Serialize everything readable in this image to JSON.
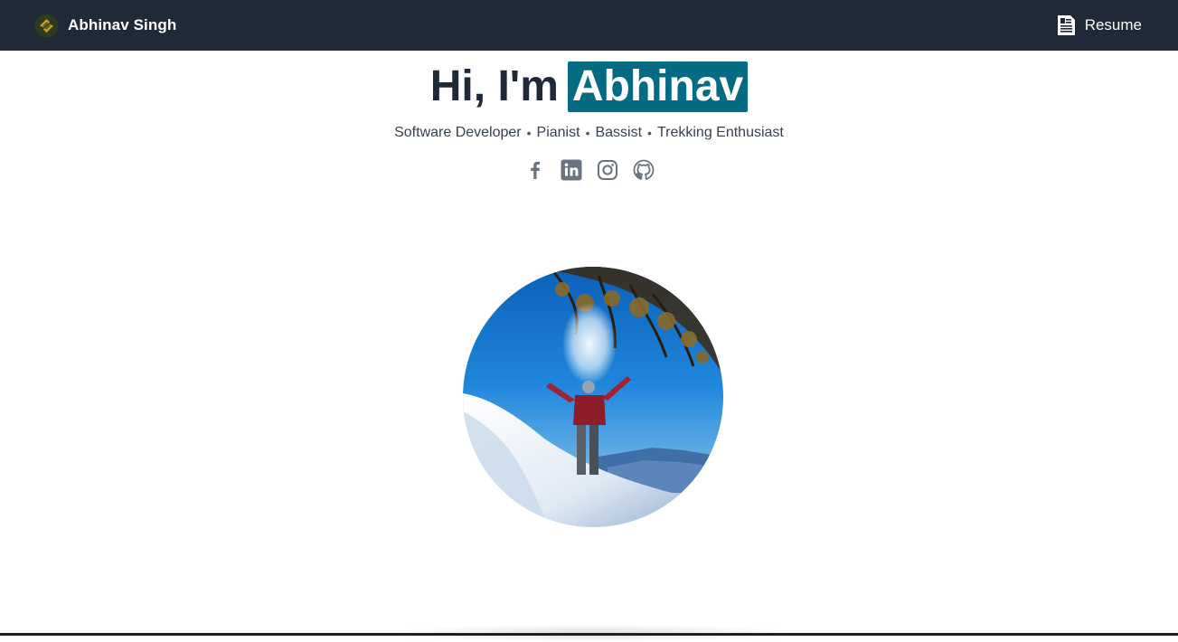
{
  "navbar": {
    "brand_name": "Abhinav Singh",
    "brand_logo_icon": "abhinav-logo-icon",
    "resume_label": "Resume",
    "resume_icon": "resume-document-icon",
    "background_color": "#1f2937"
  },
  "hero": {
    "headline_prefix": "Hi, I'm",
    "headline_name": "Abhinav",
    "highlight_color": "#056b83",
    "tagline": [
      "Software Developer",
      "Pianist",
      "Bassist",
      "Trekking Enthusiast"
    ],
    "tagline_separator": "•",
    "socials": [
      {
        "name": "facebook",
        "icon": "facebook-icon"
      },
      {
        "name": "linkedin",
        "icon": "linkedin-icon"
      },
      {
        "name": "instagram",
        "icon": "instagram-icon"
      },
      {
        "name": "github",
        "icon": "github-icon"
      }
    ],
    "photo": "profile-photo-snow-mountain"
  }
}
